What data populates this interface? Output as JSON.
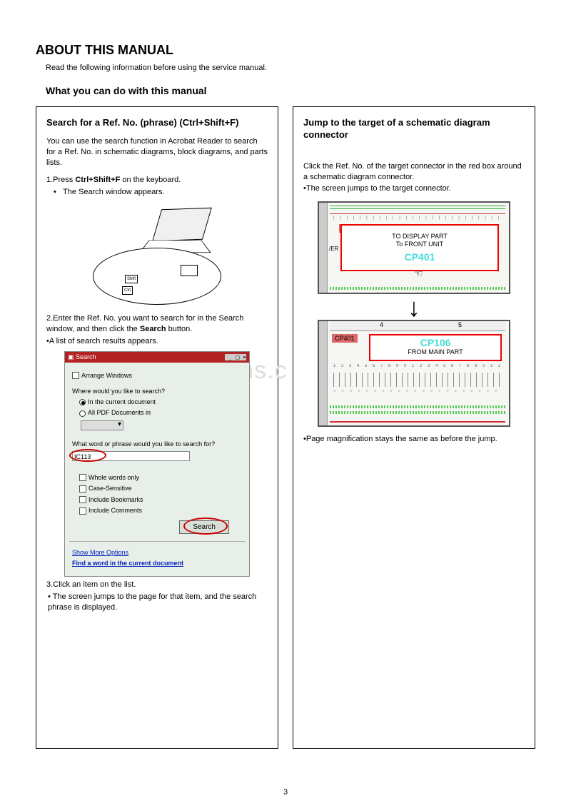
{
  "title": "ABOUT THIS MANUAL",
  "intro": "Read the following information before using the service manual.",
  "subtitle": "What you can do with this manual",
  "watermark": "www.radiofans.c",
  "pageNumber": "3",
  "left": {
    "heading": "Search for a Ref. No. (phrase) (Ctrl+Shift+F)",
    "para1": "You can use the search function in Acrobat Reader to search for a Ref. No. in schematic diagrams, block diagrams, and parts lists.",
    "step1_prefix": "1.Press ",
    "step1_bold": "Ctrl+Shift+F",
    "step1_suffix": " on the keyboard.",
    "bullet1": "The Search window appears.",
    "key_shift": "Shift",
    "key_ctrl": "Ctrl",
    "step2_prefix": "2.Enter the Ref. No. you want to search for in the Search window, and then click the ",
    "step2_bold": "Search",
    "step2_suffix": " button.",
    "bullet2": "•A list of search results appears.",
    "searchWin": {
      "title": "Search",
      "closeIcons": "_ □ ×",
      "arrange": "Arrange Windows",
      "q1": "Where would you like to search?",
      "opt1": "In the current document",
      "opt2": "All PDF Documents in",
      "q2": "What word or phrase would you like to search for?",
      "input": "IC113",
      "chk1": "Whole words only",
      "chk2": "Case-Sensitive",
      "chk3": "Include Bookmarks",
      "chk4": "Include Comments",
      "btn": "Search",
      "link1": "Show More Options",
      "link2": "Find a word in the current document"
    },
    "step3": "3.Click an item on the list.",
    "bullet3": "• The screen jumps to the page for that item, and the search phrase is displayed."
  },
  "right": {
    "heading": "Jump to the target of a schematic diagram connector",
    "para1": "Click the Ref. No. of the target connector in the red box around a schematic diagram connector.",
    "bullet1": "•The screen jumps to the target connector.",
    "schem1": {
      "label": "CP106",
      "sideLabel": "/ER",
      "text1": "TO DISPLAY PART",
      "text2": "To FRONT UNIT",
      "cp": "CP401"
    },
    "schem2": {
      "label": "CP401",
      "ruler4": "4",
      "ruler5": "5",
      "cp": "CP106",
      "text": "FROM MAIN PART"
    },
    "bullet2": "•Page magnification stays the same as before the jump."
  }
}
